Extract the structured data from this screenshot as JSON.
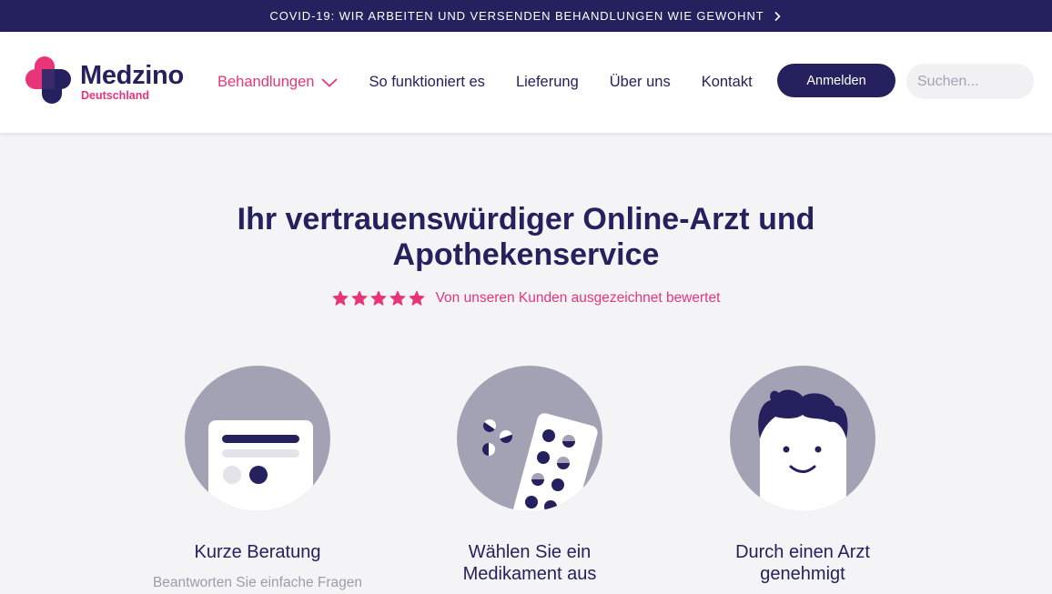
{
  "banner": {
    "text": "COVID-19: WIR ARBEITEN UND VERSENDEN BEHANDLUNGEN WIE GEWOHNT"
  },
  "logo": {
    "title": "Medzino",
    "subtitle": "Deutschland"
  },
  "nav": {
    "items": [
      {
        "label": "Behandlungen",
        "active": true,
        "has_dropdown": true
      },
      {
        "label": "So funktioniert es"
      },
      {
        "label": "Lieferung"
      },
      {
        "label": "Über uns"
      },
      {
        "label": "Kontakt"
      }
    ]
  },
  "login": {
    "label": "Anmelden"
  },
  "search": {
    "placeholder": "Suchen..."
  },
  "hero": {
    "title": "Ihr vertrauenswürdiger Online-Arzt und Apothekenservice",
    "rating_stars": 5,
    "rating_text": "Von unseren Kunden ausgezeichnet bewertet"
  },
  "steps": [
    {
      "title": "Kurze Beratung",
      "desc": "Beantworten Sie einfache Fragen"
    },
    {
      "title": "Wählen Sie ein Medikament aus",
      "desc": ""
    },
    {
      "title": "Durch einen Arzt genehmigt",
      "desc": ""
    }
  ],
  "colors": {
    "navy": "#24215e",
    "pink": "#e8357a",
    "grey_circle": "#a3a2b4",
    "background": "#f4f4f6"
  }
}
